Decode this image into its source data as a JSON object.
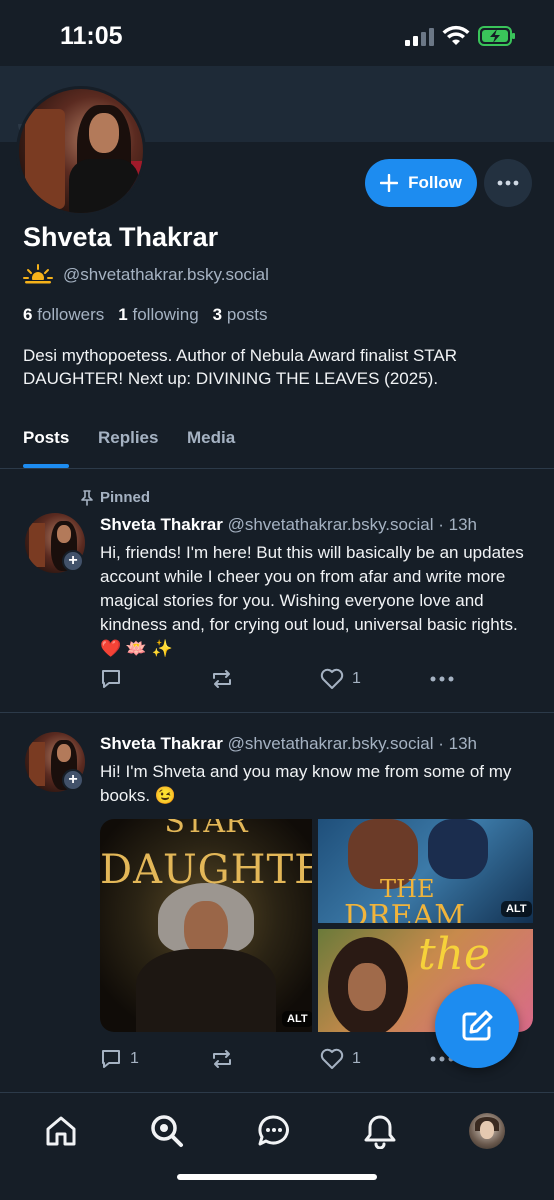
{
  "status_bar": {
    "time": "11:05"
  },
  "profile": {
    "display_name": "Shveta Thakrar",
    "handle": "@shvetathakrar.bsky.social",
    "emoji": "🌅",
    "followers_count": "6",
    "followers_label": "followers",
    "following_count": "1",
    "following_label": "following",
    "posts_count": "3",
    "posts_label": "posts",
    "bio": "Desi mythopoetess. Author of Nebula Award finalist STAR DAUGHTER! Next up: DIVINING THE LEAVES (2025).",
    "follow_label": "Follow"
  },
  "tabs": [
    {
      "label": "Posts",
      "active": true
    },
    {
      "label": "Replies",
      "active": false
    },
    {
      "label": "Media",
      "active": false
    }
  ],
  "posts": [
    {
      "pinned_label": "Pinned",
      "author": "Shveta Thakrar",
      "handle": "@shvetathakrar.bsky.social",
      "sep": "·",
      "time": "13h",
      "text": "Hi, friends! I'm here! But this will basically be an updates account while I cheer you on from afar and write more magical stories for you. Wishing everyone love and kindness and, for crying out loud, universal basic rights. ❤️ 🪷 ✨",
      "reply_count": "",
      "like_count": "1"
    },
    {
      "author": "Shveta Thakrar",
      "handle": "@shvetathakrar.bsky.social",
      "sep": "·",
      "time": "13h",
      "text": "Hi! I'm Shveta and you may know me from some of my books. 😉",
      "reply_count": "1",
      "like_count": "1",
      "images": [
        {
          "title_top": "STAR",
          "title": "DAUGHTER",
          "alt": "ALT"
        },
        {
          "title1": "THE",
          "title2": "DREAM",
          "alt": "ALT"
        },
        {
          "title": "the"
        }
      ]
    }
  ],
  "icons": {
    "nav": [
      "home-icon",
      "search-icon",
      "chat-icon",
      "bell-icon",
      "profile-avatar"
    ],
    "fab": "compose-icon"
  },
  "colors": {
    "accent": "#1d8cf0",
    "background": "#161e27",
    "muted": "#a5b2c2"
  }
}
